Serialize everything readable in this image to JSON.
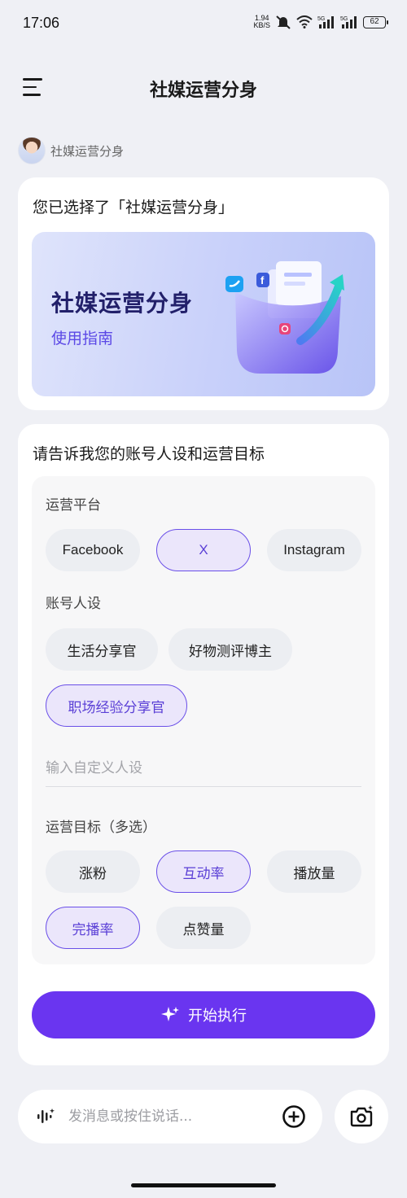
{
  "status_bar": {
    "time": "17:06",
    "net_speed_value": "1.94",
    "net_speed_unit": "KB/S",
    "signal_1": "5G",
    "signal_2": "5G",
    "battery": "62"
  },
  "header": {
    "title": "社媒运营分身",
    "menu_icon": "hamburger-menu-icon"
  },
  "bot": {
    "name": "社媒运营分身"
  },
  "selection_card": {
    "title": "您已选择了「社媒运营分身」",
    "banner_title": "社媒运营分身",
    "banner_link": "使用指南"
  },
  "form_card": {
    "title": "请告诉我您的账号人设和运营目标",
    "platform": {
      "label": "运营平台",
      "options": [
        "Facebook",
        "X",
        "Instagram"
      ],
      "selected": [
        "X"
      ]
    },
    "persona": {
      "label": "账号人设",
      "options": [
        "生活分享官",
        "好物测评博主",
        "职场经验分享官"
      ],
      "selected": [
        "职场经验分享官"
      ],
      "custom_placeholder": "输入自定义人设"
    },
    "goal": {
      "label": "运营目标（多选）",
      "options": [
        "涨粉",
        "互动率",
        "播放量",
        "完播率",
        "点赞量"
      ],
      "selected": [
        "互动率",
        "完播率"
      ]
    },
    "start_button": "开始执行"
  },
  "bottom_bar": {
    "placeholder": "发消息或按住说话...",
    "voice_icon": "voice-wave-icon",
    "add_icon": "plus-circle-icon",
    "camera_icon": "camera-sparkle-icon"
  },
  "colors": {
    "accent": "#6a35f0",
    "chip_selected_bg": "#ebe6fb",
    "chip_bg": "#eceef2",
    "page_bg": "#eff0f5"
  }
}
